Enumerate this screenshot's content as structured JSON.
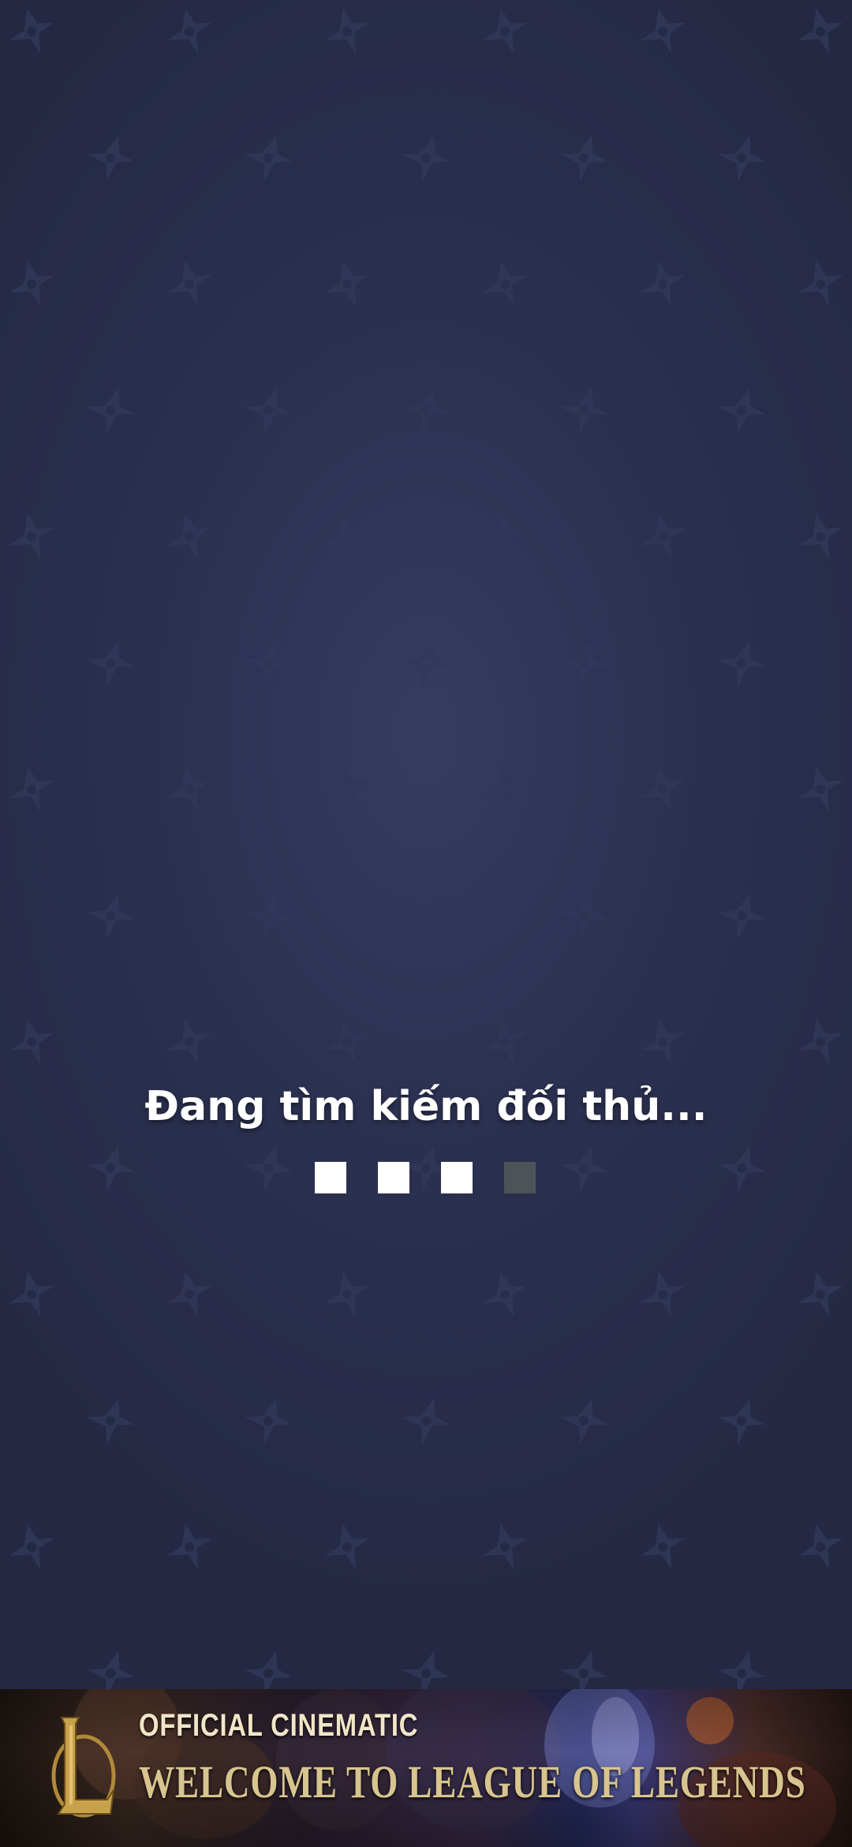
{
  "matchmaking": {
    "status_text": "Đang tìm kiếm đối thủ...",
    "loading_indicator": {
      "total_steps": 4,
      "completed_steps": 3,
      "active_color": "#ffffff",
      "inactive_color": "#4e5358"
    }
  },
  "colors": {
    "background": "#2b3050",
    "pattern_icon": "#323859"
  },
  "background_pattern_icon": "shuriken-icon",
  "ad_banner": {
    "subtitle": "OFFICIAL CINEMATIC",
    "title": "WELCOME TO LEAGUE OF LEGENDS",
    "logo_icon": "league-of-legends-logo",
    "logo_color": "#c8a24a",
    "text_color": "#d8c48e"
  }
}
